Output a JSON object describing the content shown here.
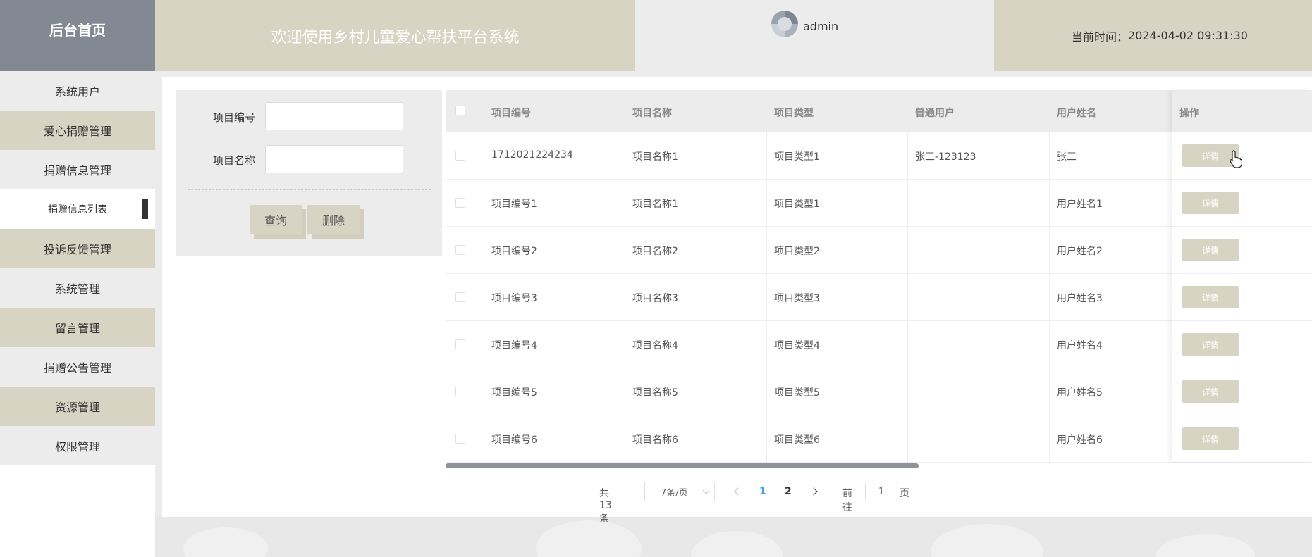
{
  "header": {
    "brand": "后台首页",
    "welcome": "欢迎使用乡村儿童爱心帮扶平台系统",
    "username": "admin",
    "time_label": "当前时间：",
    "time_value": "2024-04-02 09:31:30"
  },
  "sidebar": {
    "items": [
      {
        "label": "系统用户"
      },
      {
        "label": "爱心捐赠管理"
      },
      {
        "label": "捐赠信息管理"
      },
      {
        "label": "捐赠信息列表"
      },
      {
        "label": "投诉反馈管理"
      },
      {
        "label": "系统管理"
      },
      {
        "label": "留言管理"
      },
      {
        "label": "捐赠公告管理"
      },
      {
        "label": "资源管理"
      },
      {
        "label": "权限管理"
      }
    ]
  },
  "search": {
    "code_label": "项目编号",
    "code_value": "",
    "name_label": "项目名称",
    "name_value": "",
    "query_button": "查询",
    "delete_button": "删除"
  },
  "table": {
    "columns": [
      "项目编号",
      "项目名称",
      "项目类型",
      "普通用户",
      "用户姓名",
      "操作"
    ],
    "detail_label": "详情",
    "rows": [
      [
        "1712021224234",
        "项目名称1",
        "项目类型1",
        "张三-123123",
        "张三"
      ],
      [
        "项目编号1",
        "项目名称1",
        "项目类型1",
        "",
        "用户姓名1"
      ],
      [
        "项目编号2",
        "项目名称2",
        "项目类型2",
        "",
        "用户姓名2"
      ],
      [
        "项目编号3",
        "项目名称3",
        "项目类型3",
        "",
        "用户姓名3"
      ],
      [
        "项目编号4",
        "项目名称4",
        "项目类型4",
        "",
        "用户姓名4"
      ],
      [
        "项目编号5",
        "项目名称5",
        "项目类型5",
        "",
        "用户姓名5"
      ],
      [
        "项目编号6",
        "项目名称6",
        "项目类型6",
        "",
        "用户姓名6"
      ]
    ]
  },
  "pagination": {
    "total": "共 13 条",
    "page_size": "7条/页",
    "pages": [
      "1",
      "2"
    ],
    "current_page": "1",
    "goto_label": "前往",
    "goto_value": "1",
    "page_suffix": "页"
  },
  "colors": {
    "accent": "#d8d4c3",
    "brand_bg": "#838993",
    "active_page": "#409eff"
  }
}
